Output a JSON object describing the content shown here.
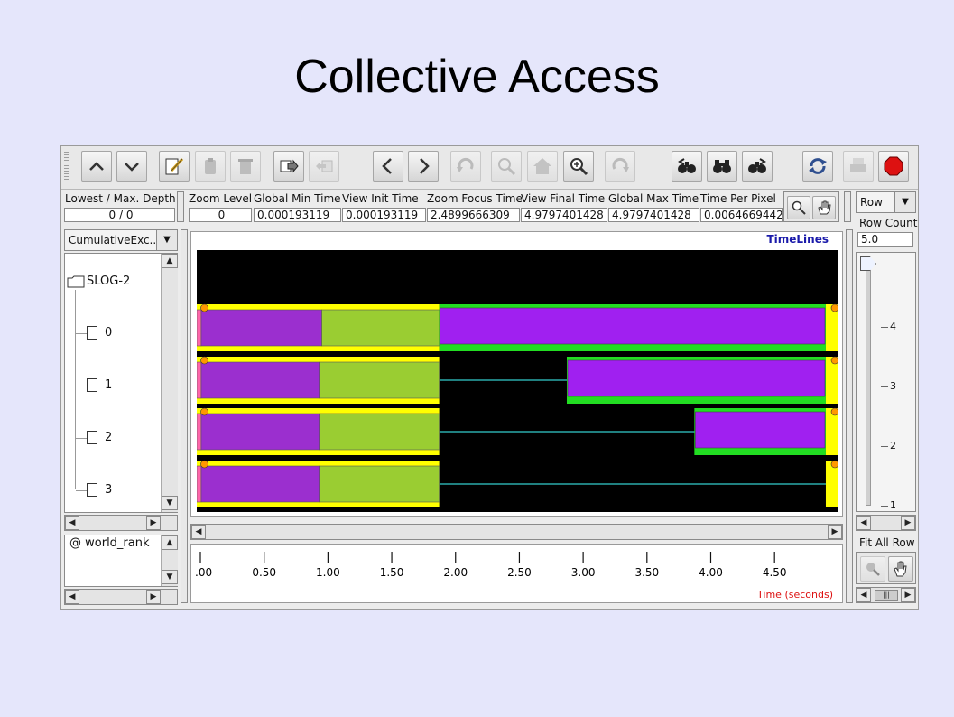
{
  "slide": {
    "title": "Collective Access"
  },
  "colors": {
    "purple": "#9b2fcf",
    "purple_bright": "#a020f0",
    "green": "#9acd32",
    "yellow": "#ffff00",
    "bright_green": "#22dd22",
    "cyan": "#33cccc",
    "canvas": "#000000",
    "pink": "#ff66aa"
  },
  "toolbar": {
    "icons": [
      "up-icon",
      "down-icon",
      "edit-icon",
      "paste-icon",
      "delete-icon",
      "export-icon",
      "import-icon",
      "back-icon",
      "forward-icon",
      "undo-icon",
      "zoom-out-icon",
      "home-icon",
      "zoom-in-icon",
      "redo-icon",
      "search-back-icon",
      "binoculars-icon",
      "search-forward-icon",
      "refresh-icon",
      "print-icon",
      "stop-icon"
    ]
  },
  "depth": {
    "label": "Lowest / Max. Depth",
    "value": "0 / 0"
  },
  "stats": {
    "headers": [
      "Zoom Level",
      "Global Min Time",
      "View  Init Time",
      "Zoom Focus Time",
      "View Final Time",
      "Global Max Time",
      "Time Per Pixel"
    ],
    "values": [
      "0",
      "0.000193119",
      "0.000193119",
      "2.4899666309",
      "4.9797401428",
      "4.9797401428",
      "0.0064669442"
    ]
  },
  "left": {
    "combo": "CumulativeExc...",
    "tree_root": "SLOG-2",
    "tree_items": [
      "0",
      "1",
      "2",
      "3"
    ],
    "rank_label": "@ world_rank"
  },
  "timeline": {
    "title": "TimeLines",
    "x_axis_label": "Time (seconds)",
    "x_ticks": [
      ".00",
      "0.50",
      "1.00",
      "1.50",
      "2.00",
      "2.50",
      "3.00",
      "3.50",
      "4.00",
      "4.50"
    ],
    "x_range": [
      0.0,
      4.9797
    ],
    "rows": [
      {
        "rank": "0",
        "segments": [
          {
            "kind": "pink",
            "t0": 0.0,
            "t1": 0.035
          },
          {
            "kind": "purple",
            "t0": 0.035,
            "t1": 0.98
          },
          {
            "kind": "green",
            "t0": 0.98,
            "t1": 1.9
          },
          {
            "kind": "purple_bright",
            "t0": 1.9,
            "t1": 4.93
          }
        ]
      },
      {
        "rank": "1",
        "segments": [
          {
            "kind": "pink",
            "t0": 0.0,
            "t1": 0.035
          },
          {
            "kind": "purple",
            "t0": 0.035,
            "t1": 0.96
          },
          {
            "kind": "green",
            "t0": 0.96,
            "t1": 1.9
          },
          {
            "kind": "purple_bright",
            "t0": 2.9,
            "t1": 4.93
          }
        ]
      },
      {
        "rank": "2",
        "segments": [
          {
            "kind": "pink",
            "t0": 0.0,
            "t1": 0.035
          },
          {
            "kind": "purple",
            "t0": 0.035,
            "t1": 0.96
          },
          {
            "kind": "green",
            "t0": 0.96,
            "t1": 1.9
          },
          {
            "kind": "purple_bright",
            "t0": 3.9,
            "t1": 4.93
          }
        ]
      },
      {
        "rank": "3",
        "segments": [
          {
            "kind": "pink",
            "t0": 0.0,
            "t1": 0.035
          },
          {
            "kind": "purple",
            "t0": 0.035,
            "t1": 0.96
          },
          {
            "kind": "green",
            "t0": 0.96,
            "t1": 1.9
          }
        ]
      }
    ]
  },
  "right": {
    "combo": "Row",
    "row_count_label": "Row Count",
    "row_count_value": "5.0",
    "slider_ticks": [
      "4",
      "3",
      "2",
      "1"
    ],
    "fit_label": "Fit All Row"
  }
}
